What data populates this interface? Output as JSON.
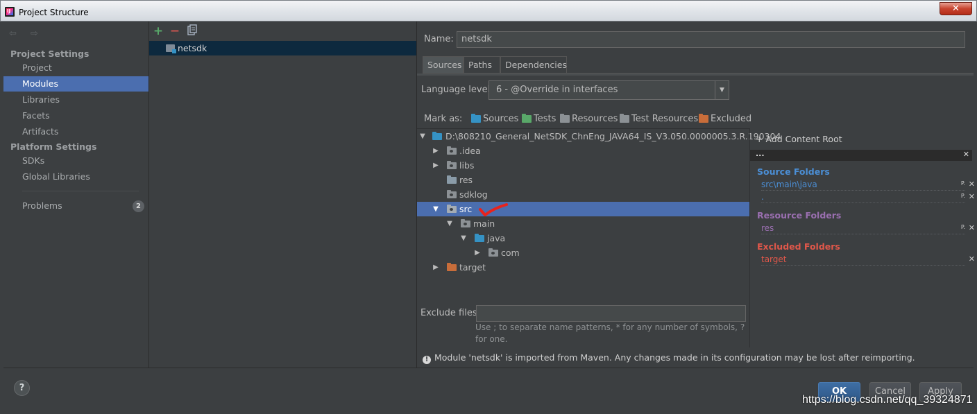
{
  "window": {
    "title": "Project Structure",
    "close_label": "✕"
  },
  "sidebar": {
    "nav_arrows": "⇦ ⇨",
    "project_settings_header": "Project Settings",
    "project_items": [
      "Project",
      "Modules",
      "Libraries",
      "Facets",
      "Artifacts"
    ],
    "selected_item": "Modules",
    "platform_settings_header": "Platform Settings",
    "platform_items": [
      "SDKs",
      "Global Libraries"
    ],
    "problems_label": "Problems",
    "problems_count": "2"
  },
  "module_list": {
    "add_label": "+",
    "remove_label": "−",
    "modules": [
      "netsdk"
    ]
  },
  "module": {
    "name_label": "Name:",
    "name_value": "netsdk",
    "tabs": [
      "Sources",
      "Paths",
      "Dependencies"
    ],
    "active_tab": "Sources",
    "language_level_label": "Language level:",
    "language_level_value": "6 - @Override in interfaces",
    "mark_as_label": "Mark as:",
    "mark_as": [
      {
        "label": "Sources",
        "color": "#3592c4"
      },
      {
        "label": "Tests",
        "color": "#59a869"
      },
      {
        "label": "Resources",
        "color": "#8c9195"
      },
      {
        "label": "Test Resources",
        "color": "#8c9195"
      },
      {
        "label": "Excluded",
        "color": "#c86d3a"
      }
    ],
    "tree": [
      {
        "label": "D:\\808210_General_NetSDK_ChnEng_JAVA64_IS_V3.050.0000005.3.R.190304",
        "toggle": "▼",
        "folder": "blue"
      },
      {
        "label": ".idea",
        "toggle": "▶",
        "folder": "grey"
      },
      {
        "label": "libs",
        "toggle": "▶",
        "folder": "grey"
      },
      {
        "label": "res",
        "toggle": "",
        "folder": "grey"
      },
      {
        "label": "sdklog",
        "toggle": "",
        "folder": "grey"
      },
      {
        "label": "src",
        "toggle": "▼",
        "folder": "grey",
        "selected": true
      },
      {
        "label": "main",
        "toggle": "▼",
        "folder": "grey"
      },
      {
        "label": "java",
        "toggle": "▼",
        "folder": "blue"
      },
      {
        "label": "com",
        "toggle": "▶",
        "folder": "grey"
      },
      {
        "label": "target",
        "toggle": "▶",
        "folder": "orange"
      }
    ],
    "exclude_files_label": "Exclude files:",
    "exclude_files_value": "",
    "exclude_hint": "Use ; to separate name patterns, * for any number of symbols, ? for one.",
    "maven_warning": "Module 'netsdk' is imported from Maven. Any changes made in its configuration may be lost after reimporting."
  },
  "content_roots": {
    "add_label": "+ Add Content Root",
    "root_path": "...",
    "source_folders_label": "Source Folders",
    "source_folders": [
      "src\\main\\java",
      "."
    ],
    "resource_folders_label": "Resource Folders",
    "resource_folders": [
      "res"
    ],
    "excluded_folders_label": "Excluded Folders",
    "excluded_folders": [
      "target"
    ],
    "colors": {
      "source": "#4b8fd6",
      "resource": "#9a6fb0",
      "excluded": "#e0574a"
    }
  },
  "footer": {
    "help_label": "?",
    "ok_label": "OK",
    "cancel_label": "Cancel",
    "apply_label": "Apply",
    "watermark": "https://blog.csdn.net/qq_39324871"
  }
}
